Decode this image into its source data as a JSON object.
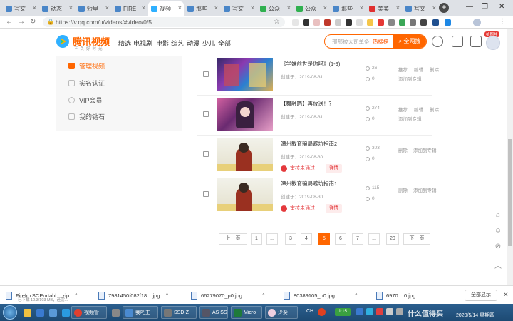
{
  "browser": {
    "tabs": [
      {
        "label": "写文",
        "color": "#4a86c8"
      },
      {
        "label": "动态",
        "color": "#4a86c8"
      },
      {
        "label": "短早",
        "color": "#4a86c8"
      },
      {
        "label": "FIRE",
        "color": "#4a86c8"
      },
      {
        "label": "视频",
        "color": "#2fb0ff",
        "active": true
      },
      {
        "label": "那些",
        "color": "#4a86c8"
      },
      {
        "label": "写文",
        "color": "#4a86c8"
      },
      {
        "label": "公众",
        "color": "#30b050"
      },
      {
        "label": "公众",
        "color": "#30b050"
      },
      {
        "label": "那些",
        "color": "#4a86c8"
      },
      {
        "label": "美美",
        "color": "#e03030"
      },
      {
        "label": "写文",
        "color": "#4a86c8"
      }
    ],
    "url": "https://v.qq.com/u/videos/#video/0/5"
  },
  "site": {
    "logo_text": "腾讯视频",
    "slogan": "不负好时光",
    "nav": [
      "精选",
      "电视剧",
      "电影",
      "综艺",
      "动漫",
      "少儿",
      "全部"
    ],
    "search_placeholder": "那那被大司单条",
    "hot_label": "热搜榜",
    "search_button": "全网搜",
    "badge": "拍照片"
  },
  "sidebar": {
    "items": [
      {
        "label": "管理视频",
        "active": true
      },
      {
        "label": "实名认证"
      },
      {
        "label": "VIP会员"
      },
      {
        "label": "我的钻石"
      }
    ]
  },
  "videos": [
    {
      "title": "《学妹前世是你吗》(1-9)",
      "date": "创建于：2019-08-31",
      "plays": "26",
      "comments": "0",
      "actions": [
        "推荐",
        "编辑",
        "删除"
      ],
      "add_album": "添加到专辑",
      "thumb": "anime"
    },
    {
      "title": "【舞融晒】再放送！？",
      "date": "创建于：2019-08-31",
      "plays": "274",
      "comments": "0",
      "actions": [
        "推荐",
        "编辑",
        "删除"
      ],
      "add_album": "添加到专辑",
      "thumb": "anime2"
    },
    {
      "title": "潭州教育骗局避坑指南2",
      "date": "创建于：2019-08-30",
      "plays": "303",
      "comments": "0",
      "actions": [
        "删除"
      ],
      "add_album": "添加到专辑",
      "status": "审核未通过",
      "detail": "详情",
      "thumb": "person"
    },
    {
      "title": "潭州教育骗局避坑指南1",
      "date": "创建于：2019-08-30",
      "plays": "115",
      "comments": "0",
      "actions": [
        "删除"
      ],
      "add_album": "添加到专辑",
      "status": "审核未通过",
      "detail": "详情",
      "thumb": "person"
    }
  ],
  "pagination": {
    "prev": "上一页",
    "pages": [
      "1",
      "...",
      "3",
      "4",
      "5",
      "6",
      "7",
      "...",
      "20"
    ],
    "current": "5",
    "next": "下一页"
  },
  "downloads": [
    {
      "name": "FirefoxSCPortabl....zip",
      "sub": "已下载 10.3/103 MB，还需..."
    },
    {
      "name": "7981450f082f18....jpg"
    },
    {
      "name": "66279070_p0.jpg"
    },
    {
      "name": "80389105_p0.jpg"
    },
    {
      "name": "6970....0.jpg"
    }
  ],
  "show_all": "全部显示",
  "taskbar": {
    "items": [
      "视频管",
      "我吧工",
      "SSD-Z",
      "AS SS",
      "Micro",
      "少葵"
    ],
    "time": "2020/5/14 星期四",
    "lang": "CH",
    "tray_badge": "1:15"
  },
  "watermark": "什么值得买"
}
